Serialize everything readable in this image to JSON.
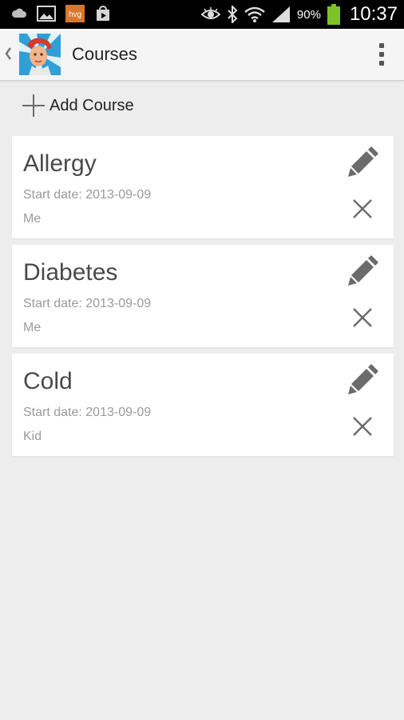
{
  "status_bar": {
    "battery_percent": "90%",
    "time": "10:37",
    "icons": [
      "cloud-icon",
      "gallery-icon",
      "hvg-app-icon",
      "play-store-icon",
      "eye-icon",
      "bluetooth-icon",
      "wifi-icon",
      "signal-icon",
      "battery-icon"
    ]
  },
  "action_bar": {
    "title": "Courses",
    "icons": [
      "up-caret-icon",
      "app-logo",
      "overflow-menu-icon"
    ]
  },
  "add_course": {
    "label": "Add Course",
    "icon": "plus-icon"
  },
  "courses": [
    {
      "name": "Allergy",
      "start": "Start date: 2013-09-09",
      "owner": "Me"
    },
    {
      "name": "Diabetes",
      "start": "Start date: 2013-09-09",
      "owner": "Me"
    },
    {
      "name": "Cold",
      "start": "Start date: 2013-09-09",
      "owner": "Kid"
    }
  ],
  "colors": {
    "status_bar_bg": "#000000",
    "action_bar_bg": "#f5f5f5",
    "page_bg": "#ededed",
    "card_bg": "#ffffff",
    "battery_green": "#7ec22a",
    "icon_gray": "#6b6b6b"
  }
}
